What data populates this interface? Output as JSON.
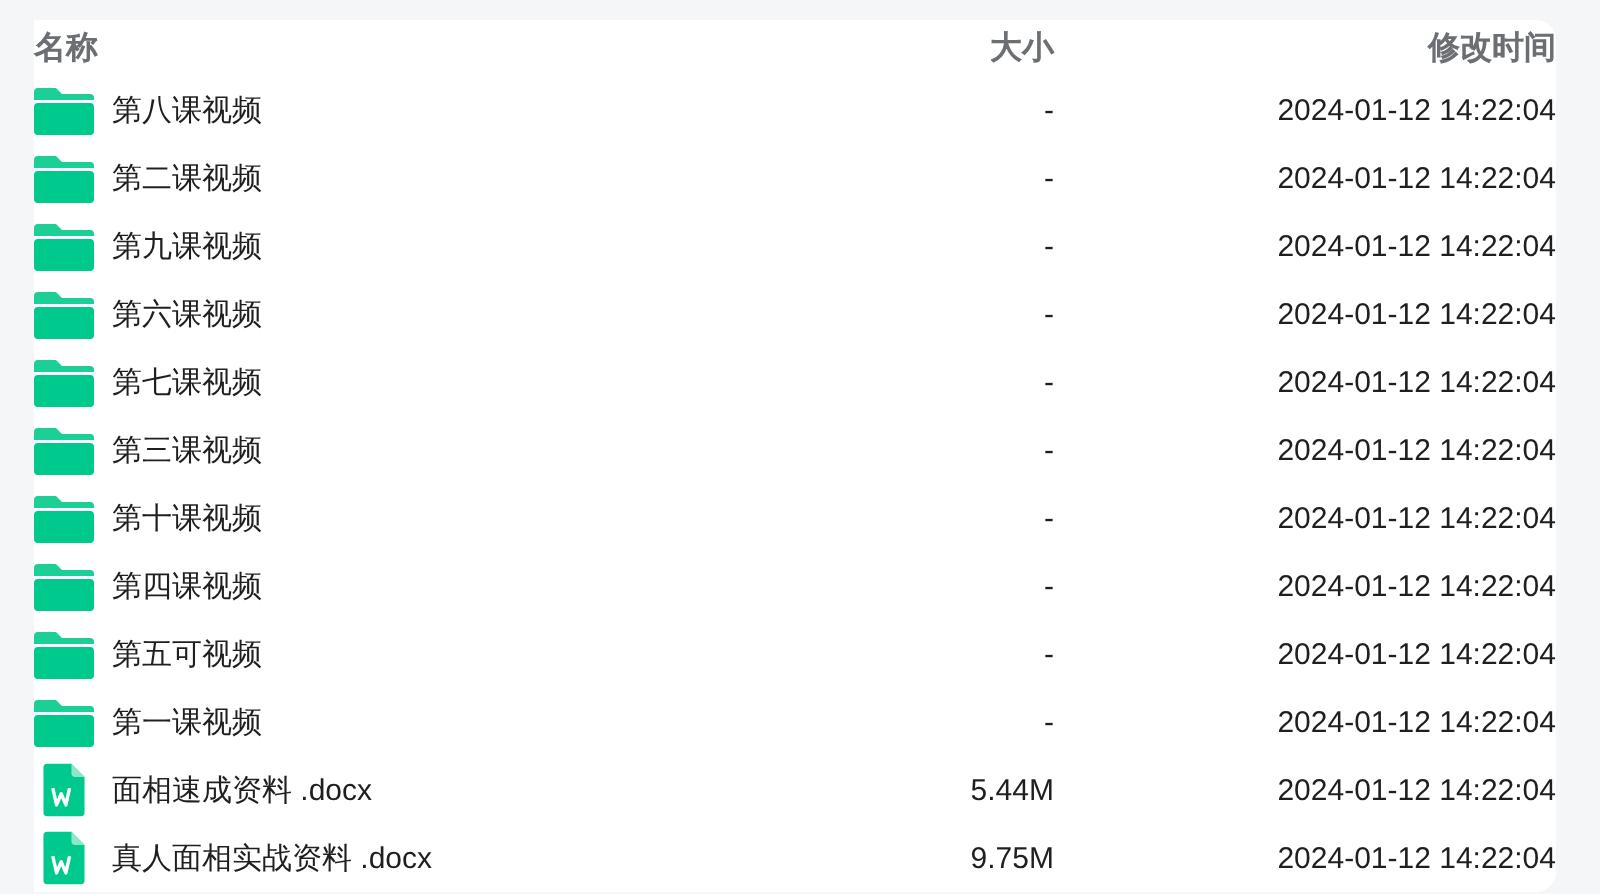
{
  "table": {
    "columns": [
      "名称",
      "大小",
      "修改时间"
    ],
    "rows": [
      {
        "kind": "folder",
        "name": "第八课视频",
        "size": "-",
        "modified": "2024-01-12 14:22:04"
      },
      {
        "kind": "folder",
        "name": "第二课视频",
        "size": "-",
        "modified": "2024-01-12 14:22:04"
      },
      {
        "kind": "folder",
        "name": "第九课视频",
        "size": "-",
        "modified": "2024-01-12 14:22:04"
      },
      {
        "kind": "folder",
        "name": "第六课视频",
        "size": "-",
        "modified": "2024-01-12 14:22:04"
      },
      {
        "kind": "folder",
        "name": "第七课视频",
        "size": "-",
        "modified": "2024-01-12 14:22:04"
      },
      {
        "kind": "folder",
        "name": "第三课视频",
        "size": "-",
        "modified": "2024-01-12 14:22:04"
      },
      {
        "kind": "folder",
        "name": "第十课视频",
        "size": "-",
        "modified": "2024-01-12 14:22:04"
      },
      {
        "kind": "folder",
        "name": "第四课视频",
        "size": "-",
        "modified": "2024-01-12 14:22:04"
      },
      {
        "kind": "folder",
        "name": "第五可视频",
        "size": "-",
        "modified": "2024-01-12 14:22:04"
      },
      {
        "kind": "folder",
        "name": "第一课视频",
        "size": "-",
        "modified": "2024-01-12 14:22:04"
      },
      {
        "kind": "word",
        "name": "面相速成资料 .docx",
        "size": "5.44M",
        "modified": "2024-01-12 14:22:04"
      },
      {
        "kind": "word",
        "name": "真人面相实战资料 .docx",
        "size": "9.75M",
        "modified": "2024-01-12 14:22:04"
      }
    ]
  }
}
